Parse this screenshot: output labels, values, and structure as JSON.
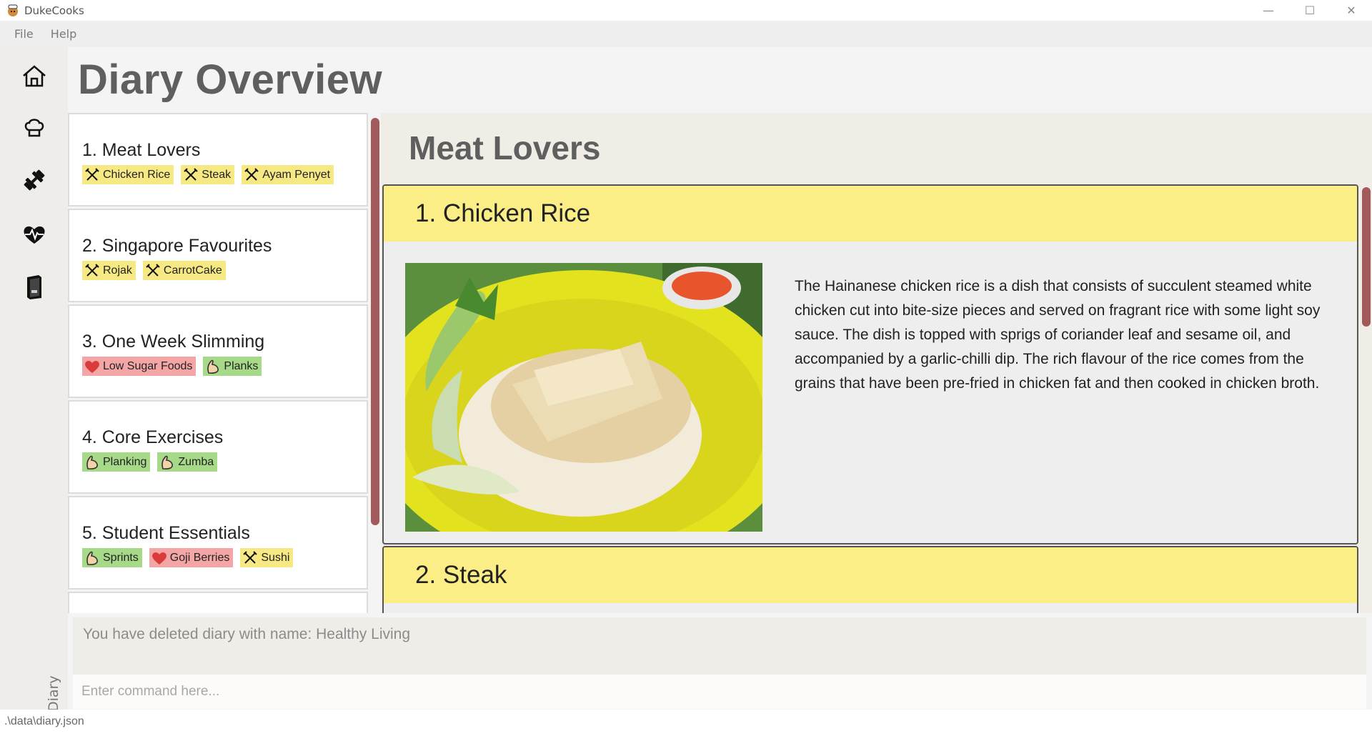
{
  "window": {
    "title": "DukeCooks"
  },
  "menu": {
    "items": [
      {
        "label": "File"
      },
      {
        "label": "Help"
      }
    ]
  },
  "sidebar": {
    "icons": [
      "home-icon",
      "chef-hat-icon",
      "dumbbell-icon",
      "heartbeat-icon",
      "book-icon"
    ],
    "label": "Diary"
  },
  "page": {
    "title": "Diary Overview"
  },
  "diaries": [
    {
      "title": "1.  Meat Lovers",
      "tags": [
        {
          "label": "Chicken Rice",
          "kind": "food"
        },
        {
          "label": "Steak",
          "kind": "food"
        },
        {
          "label": "Ayam Penyet",
          "kind": "food"
        }
      ]
    },
    {
      "title": "2.  Singapore Favourites",
      "tags": [
        {
          "label": "Rojak",
          "kind": "food"
        },
        {
          "label": "CarrotCake",
          "kind": "food"
        }
      ]
    },
    {
      "title": "3.  One Week Slimming",
      "tags": [
        {
          "label": "Low Sugar Foods",
          "kind": "health"
        },
        {
          "label": "Planks",
          "kind": "exercise"
        }
      ]
    },
    {
      "title": "4.  Core Exercises",
      "tags": [
        {
          "label": "Planking",
          "kind": "exercise"
        },
        {
          "label": "Zumba",
          "kind": "exercise"
        }
      ]
    },
    {
      "title": "5.  Student Essentials",
      "tags": [
        {
          "label": "Sprints",
          "kind": "exercise"
        },
        {
          "label": "Goji Berries",
          "kind": "health"
        },
        {
          "label": "Sushi",
          "kind": "food"
        }
      ]
    }
  ],
  "detail": {
    "title": "Meat Lovers",
    "entries": [
      {
        "title": "1. Chicken Rice",
        "description": "The Hainanese chicken rice is a dish that consists of succulent steamed white chicken cut into bite-size pieces and served on fragrant rice with some light soy sauce. The dish is topped with sprigs of coriander leaf and sesame oil, and accompanied by a garlic-chilli dip. The rich flavour of the rice comes from the grains that have been pre-fried in chicken fat and then cooked in chicken broth."
      },
      {
        "title": "2. Steak"
      }
    ]
  },
  "result": {
    "message": "You have deleted diary with name: Healthy Living"
  },
  "command": {
    "placeholder": "Enter command here..."
  },
  "status": {
    "path": ".\\data\\diary.json"
  },
  "colors": {
    "food_tag": "#f6e882",
    "exercise_tag": "#a6d988",
    "health_tag": "#f4a6a6",
    "entry_header": "#fbee86",
    "scrollbar": "#a35a5a"
  }
}
